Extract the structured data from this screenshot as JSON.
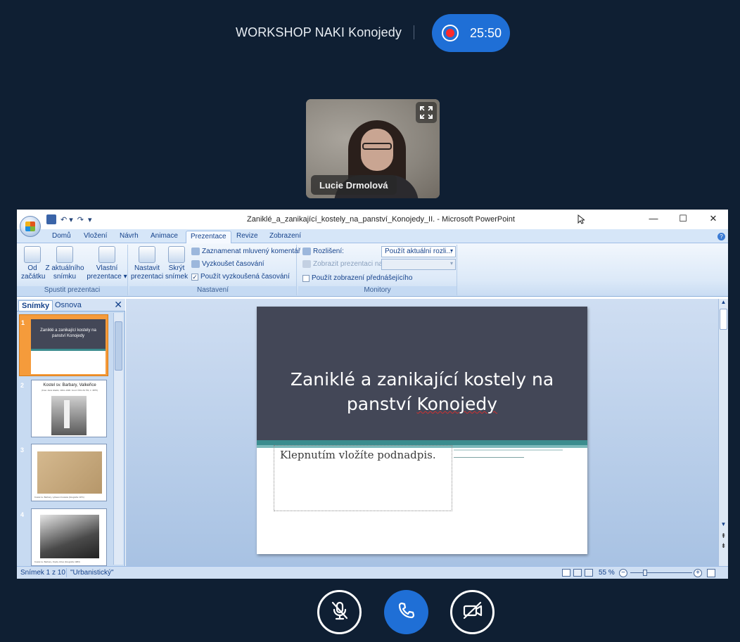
{
  "meeting": {
    "title": "WORKSHOP NAKI Konojedy",
    "recording_time": "25:50"
  },
  "participant": {
    "name": "Lucie Drmolová"
  },
  "powerpoint": {
    "window_title": "Zaniklé_a_zanikající_kostely_na_panství_Konojedy_II. - Microsoft PowerPoint",
    "tabs": [
      "Domů",
      "Vložení",
      "Návrh",
      "Animace",
      "Prezentace",
      "Revize",
      "Zobrazení"
    ],
    "active_tab": "Prezentace",
    "ribbon": {
      "group1": {
        "label": "Spustit prezentaci",
        "btn_from_start_l1": "Od",
        "btn_from_start_l2": "začátku",
        "btn_from_current_l1": "Z aktuálního",
        "btn_from_current_l2": "snímku",
        "btn_custom_l1": "Vlastní",
        "btn_custom_l2": "prezentace ▾"
      },
      "group2": {
        "label": "Nastavení",
        "btn_setup_l1": "Nastavit",
        "btn_setup_l2": "prezentaci",
        "btn_hide_l1": "Skrýt",
        "btn_hide_l2": "snímek",
        "record_narration": "Zaznamenat mluvený komentář",
        "rehearse_timings": "Vyzkoušet časování",
        "use_timings": "Použít vyzkoušená časování",
        "use_timings_checked": "✓"
      },
      "group3": {
        "label": "Monitory",
        "resolution_label": "Rozlišení:",
        "resolution_value": "Použít aktuální rozli...",
        "show_on_label": "Zobrazit prezentaci na:",
        "show_on_value": "",
        "presenter_view": "Použít zobrazení přednášejícího"
      }
    },
    "panel": {
      "tab_slides": "Snímky",
      "tab_outline": "Osnova",
      "thumbs": [
        {
          "num": "1",
          "title": "Zaniklé a zanikající kostely na panství Konojedy"
        },
        {
          "num": "2",
          "title": "Kostel sv. Barbary, Valkeřice",
          "caption": "(Foto: Alois Hladík, 1934–1936. Fond: ÚDU AV ČR, č. 3875)"
        },
        {
          "num": "3",
          "caption": "Kostel sv. Barbary, vybavení kostela (fotografie 1971)"
        },
        {
          "num": "4",
          "caption": "Kostel sv. Barbary, zbytky zdiva (fotografie 1983)"
        }
      ]
    },
    "slide": {
      "title_line1": "Zaniklé a zanikající kostely na",
      "title_line2_a": "panství ",
      "title_line2_b": "Konojedy",
      "subtitle_placeholder": "Klepnutím vložíte podnadpis."
    },
    "status": {
      "slide_counter": "Snímek 1 z 10",
      "theme": "\"Urbanistický\"",
      "zoom": "55 %"
    }
  },
  "controls": {
    "mic": "microphone-muted-icon",
    "hangup": "phone-icon",
    "camera": "camera-off-icon"
  }
}
